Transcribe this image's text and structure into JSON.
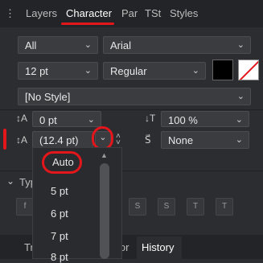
{
  "tabs": [
    "Layers",
    "Character",
    "Par",
    "TSt",
    "Styles"
  ],
  "char": {
    "collection": "All",
    "font": "Arial",
    "size": "12 pt",
    "weight": "Regular",
    "style": "[No Style]",
    "tracking": "0 pt",
    "leading": "(12.4 pt)",
    "vscale": "100 %",
    "strike": "None"
  },
  "section_label": "Typ",
  "leading_options": [
    "Auto",
    "5 pt",
    "6 pt",
    "7 pt",
    "8 pt"
  ],
  "bottom_tabs": [
    "Tr",
    "ator",
    "History"
  ]
}
